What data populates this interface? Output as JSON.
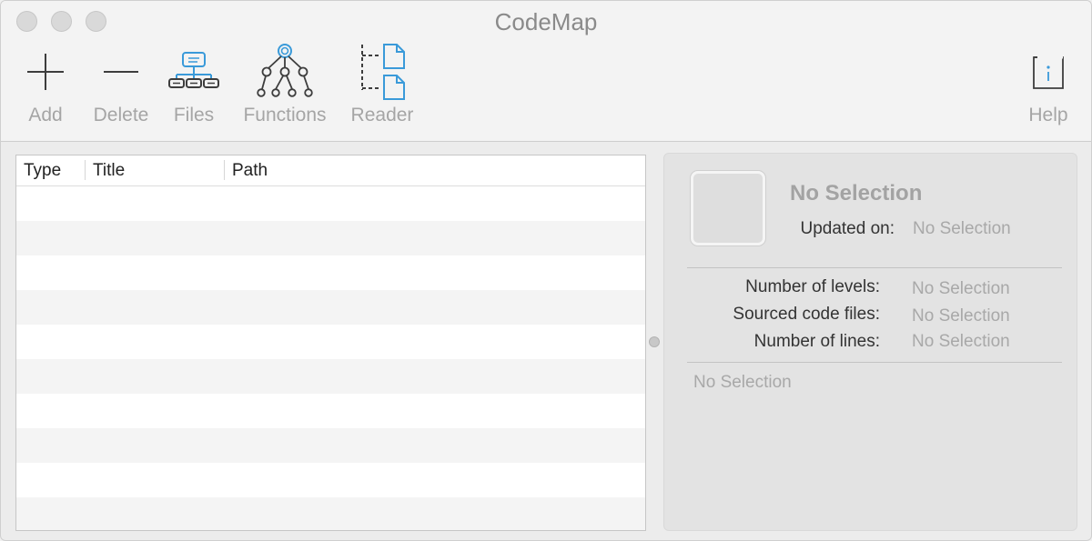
{
  "window": {
    "title": "CodeMap"
  },
  "toolbar": {
    "add_label": "Add",
    "delete_label": "Delete",
    "files_label": "Files",
    "functions_label": "Functions",
    "reader_label": "Reader",
    "help_label": "Help"
  },
  "table": {
    "columns": [
      "Type",
      "Title",
      "Path"
    ],
    "rows": []
  },
  "detail": {
    "selection_title": "No Selection",
    "updated_label": "Updated on:",
    "updated_value": "No Selection",
    "levels_label": "Number of levels:",
    "levels_value": "No Selection",
    "sourced_label": "Sourced code files:",
    "sourced_value": "No Selection",
    "lines_label": "Number of lines:",
    "lines_value": "No Selection",
    "notes_value": "No Selection"
  },
  "colors": {
    "accent": "#3a9ad9",
    "icon_dark": "#4a4a4a",
    "label_gray": "#a5a5a5"
  }
}
